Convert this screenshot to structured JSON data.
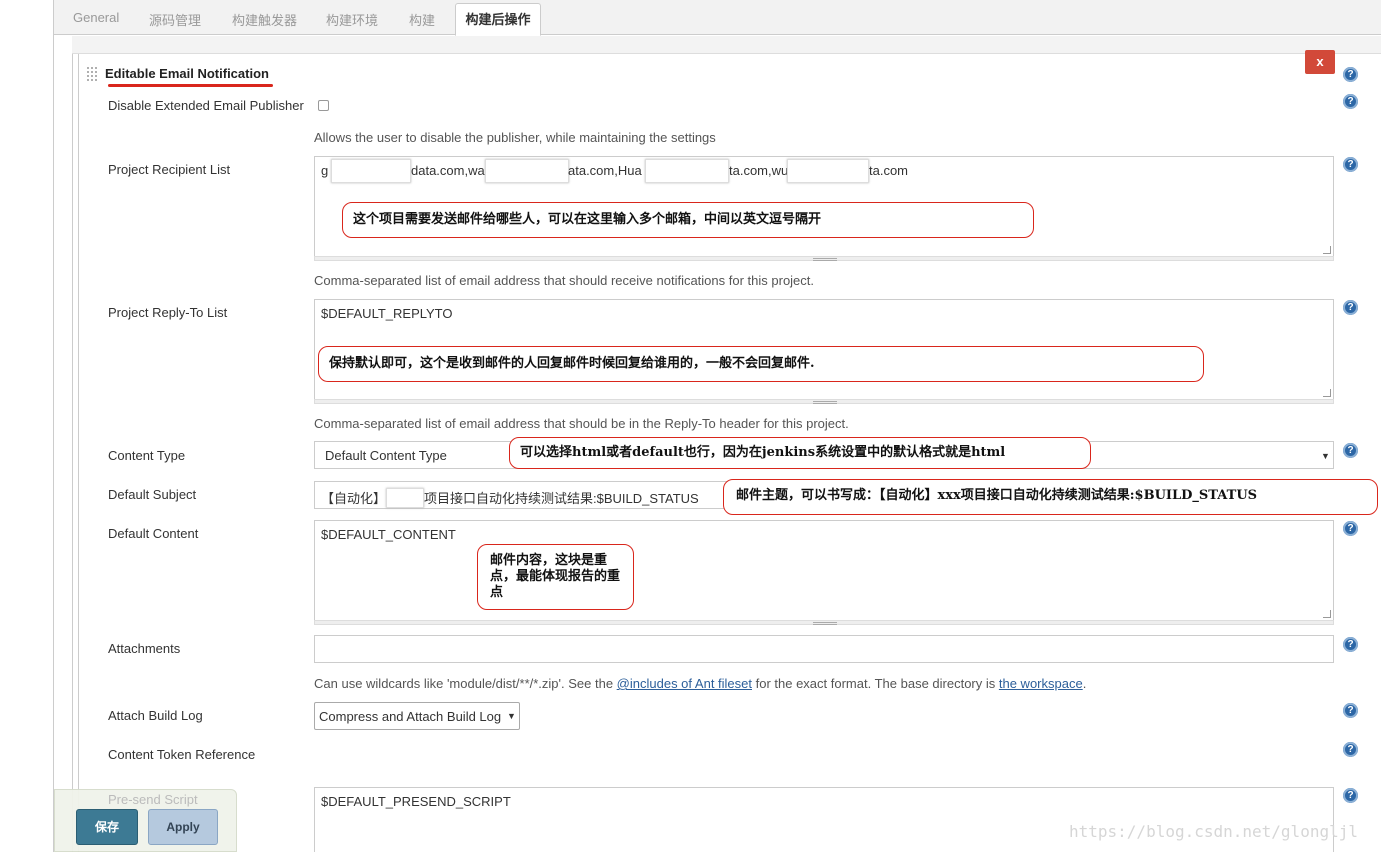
{
  "tabs": [
    "General",
    "源码管理",
    "构建触发器",
    "构建环境",
    "构建",
    "构建后操作"
  ],
  "section": {
    "title": "Editable Email Notification",
    "delete_label": "x",
    "help_label": "?"
  },
  "fields": {
    "disable_publisher": {
      "label": "Disable Extended Email Publisher",
      "checked": false,
      "description": "Allows the user to disable the publisher, while maintaining the settings"
    },
    "recipient_list": {
      "label": "Project Recipient List",
      "value_parts": [
        "g",
        "data.com,wa",
        "ata.com,Hua",
        "ta.com,wu",
        "ta.com"
      ],
      "description": "Comma-separated list of email address that should receive notifications for this project."
    },
    "reply_to": {
      "label": "Project Reply-To List",
      "value": "$DEFAULT_REPLYTO",
      "description": "Comma-separated list of email address that should be in the Reply-To header for this project."
    },
    "content_type": {
      "label": "Content Type",
      "selected": "Default Content Type"
    },
    "default_subject": {
      "label": "Default Subject",
      "value_prefix": "【自动化】",
      "value_suffix": "项目接口自动化持续测试结果:$BUILD_STATUS"
    },
    "default_content": {
      "label": "Default Content",
      "value": "$DEFAULT_CONTENT"
    },
    "attachments": {
      "label": "Attachments",
      "value": "",
      "desc_1": "Can use wildcards like 'module/dist/**/*.zip'. See the ",
      "desc_link_1": "@includes of Ant fileset",
      "desc_2": " for the exact format. The base directory is ",
      "desc_link_2": "the workspace",
      "desc_3": "."
    },
    "attach_build_log": {
      "label": "Attach Build Log",
      "selected": "Compress and Attach Build Log"
    },
    "content_token": {
      "label": "Content Token Reference"
    },
    "pre_send_script": {
      "label": "Pre-send Script",
      "value": "$DEFAULT_PRESEND_SCRIPT"
    }
  },
  "annotations": {
    "recipient": "这个项目需要发送邮件给哪些人，可以在这里输入多个邮箱，中间以英文逗号隔开",
    "reply_to": "保持默认即可，这个是收到邮件的人回复邮件时候回复给谁用的，一般不会回复邮件.",
    "content_type": "可以选择html或者default也行，因为在jenkins系统设置中的默认格式就是html",
    "subject": "邮件主题，可以书写成：【自动化】xxx项目接口自动化持续测试结果:$BUILD_STATUS",
    "content": "邮件内容，这块是重点，最能体现报告的重点"
  },
  "buttons": {
    "save": "保存",
    "apply": "Apply"
  },
  "watermark": "https://blog.csdn.net/glongljl"
}
